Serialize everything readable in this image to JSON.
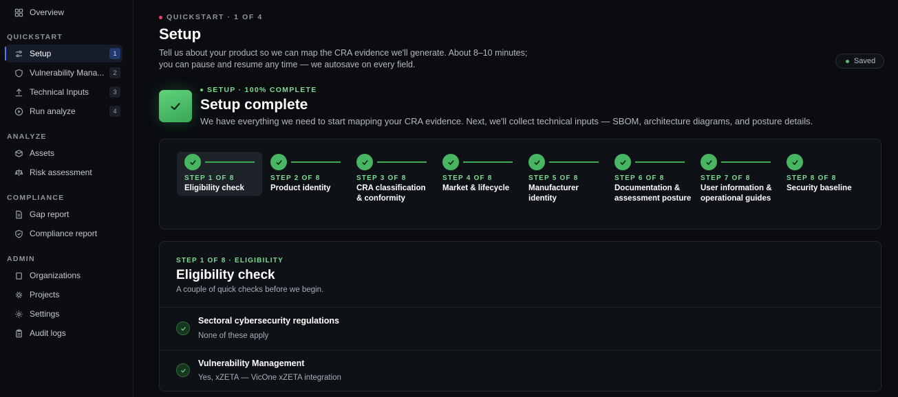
{
  "sidebar": {
    "overview": {
      "label": "Overview",
      "icon": "grid-icon"
    },
    "sections": {
      "quickstart": "QUICKSTART",
      "analyze": "ANALYZE",
      "compliance": "COMPLIANCE",
      "admin": "ADMIN"
    },
    "quickstart_items": [
      {
        "label": "Setup",
        "count": "1",
        "icon": "sliders-icon",
        "active": true
      },
      {
        "label": "Vulnerability Mana...",
        "count": "2",
        "icon": "shield-icon"
      },
      {
        "label": "Technical Inputs",
        "count": "3",
        "icon": "upload-icon"
      },
      {
        "label": "Run analyze",
        "count": "4",
        "icon": "play-circle-icon"
      }
    ],
    "analyze_items": [
      {
        "label": "Assets",
        "icon": "box-icon"
      },
      {
        "label": "Risk assessment",
        "icon": "scale-icon"
      }
    ],
    "compliance_items": [
      {
        "label": "Gap report",
        "icon": "document-icon"
      },
      {
        "label": "Compliance report",
        "icon": "shield-check-icon"
      }
    ],
    "admin_items": [
      {
        "label": "Organizations",
        "icon": "building-icon"
      },
      {
        "label": "Projects",
        "icon": "gear-small-icon"
      },
      {
        "label": "Settings",
        "icon": "sun-gear-icon"
      },
      {
        "label": "Audit logs",
        "icon": "clipboard-icon"
      }
    ]
  },
  "header": {
    "eyebrow": "QUICKSTART · 1 OF 4",
    "title": "Setup",
    "description": "Tell us about your product so we can map the CRA evidence we'll generate. About 8–10 minutes; you can pause and resume any time — we autosave on every field.",
    "saved_label": "Saved"
  },
  "hero": {
    "eyebrow": "SETUP · 100% COMPLETE",
    "title": "Setup complete",
    "description": "We have everything we need to start mapping your CRA evidence. Next, we'll collect technical inputs — SBOM, architecture diagrams, and posture details."
  },
  "steps": [
    {
      "num": "STEP 1 OF 8",
      "name": "Eligibility check",
      "current": true
    },
    {
      "num": "STEP 2 OF 8",
      "name": "Product identity"
    },
    {
      "num": "STEP 3 OF 8",
      "name": "CRA classification & conformity"
    },
    {
      "num": "STEP 4 OF 8",
      "name": "Market & lifecycle"
    },
    {
      "num": "STEP 5 OF 8",
      "name": "Manufacturer identity"
    },
    {
      "num": "STEP 6 OF 8",
      "name": "Documentation & assessment posture"
    },
    {
      "num": "STEP 7 OF 8",
      "name": "User information & operational guides"
    },
    {
      "num": "STEP 8 OF 8",
      "name": "Security baseline"
    }
  ],
  "card": {
    "eyebrow": "STEP 1 OF 8 · ELIGIBILITY",
    "title": "Eligibility check",
    "description": "A couple of quick checks before we begin.",
    "rows": [
      {
        "title": "Sectoral cybersecurity regulations",
        "value": "None of these apply"
      },
      {
        "title": "Vulnerability Management",
        "value": "Yes, xZETA — VicOne xZETA integration"
      }
    ]
  },
  "colors": {
    "accent": "#5b78ff",
    "success": "#48b562",
    "background": "#0a0c10"
  }
}
